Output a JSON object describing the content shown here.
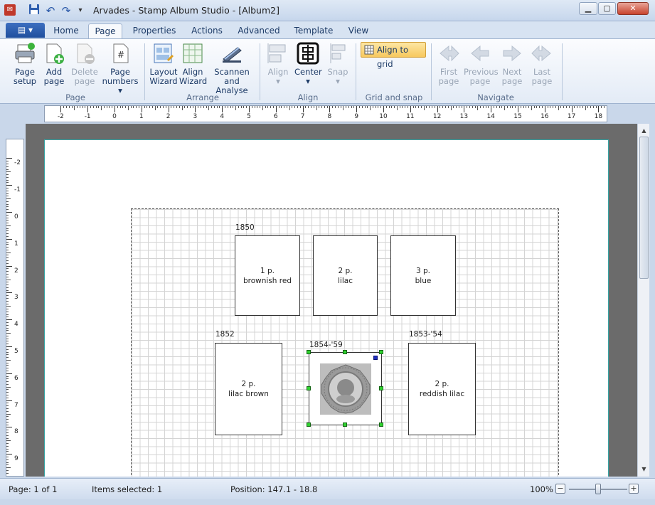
{
  "app": {
    "title": "Arvades - Stamp Album Studio - [Album2]"
  },
  "window_controls": {
    "minimize": "▁",
    "maximize": "▢",
    "close": "✕"
  },
  "tabs": {
    "file_label": "",
    "items": [
      {
        "label": "Home"
      },
      {
        "label": "Page",
        "active": true
      },
      {
        "label": "Properties"
      },
      {
        "label": "Actions"
      },
      {
        "label": "Advanced"
      },
      {
        "label": "Template"
      },
      {
        "label": "View"
      }
    ]
  },
  "ribbon": {
    "page_group": {
      "label": "Page",
      "page_setup": "Page setup",
      "add_page": "Add page",
      "delete_page": "Delete page",
      "page_numbers": "Page numbers"
    },
    "arrange_group": {
      "label": "Arrange",
      "layout_wizard": "Layout Wizard",
      "align_wizard": "Align Wizard",
      "scan_analyse": "Scannen and Analyse"
    },
    "align_group": {
      "label": "Align",
      "align": "Align",
      "center": "Center",
      "snap": "Snap"
    },
    "grid_group": {
      "label": "Grid and snap",
      "align_to_grid": "Align to grid"
    },
    "navigate_group": {
      "label": "Navigate",
      "first_page": "First page",
      "previous_page": "Previous page",
      "next_page": "Next page",
      "last_page": "Last page"
    }
  },
  "ruler": {
    "h_labels": [
      "-2",
      "-1",
      "0",
      "1",
      "2",
      "3",
      "4",
      "5",
      "6",
      "7",
      "8",
      "9",
      "10",
      "11",
      "12",
      "13",
      "14",
      "15",
      "16",
      "17",
      "18"
    ],
    "v_labels": [
      "-2",
      "-1",
      "0",
      "1",
      "2",
      "3",
      "4",
      "5",
      "6",
      "7",
      "8",
      "9"
    ]
  },
  "album": {
    "rows": [
      {
        "year": "1850"
      },
      {
        "year": "1852"
      },
      {
        "year": "1854-'59"
      },
      {
        "year": "1853-'54"
      }
    ],
    "stamps": [
      {
        "denomination": "1 p.",
        "color": "brownish red"
      },
      {
        "denomination": "2 p.",
        "color": "lilac"
      },
      {
        "denomination": "3 p.",
        "color": "blue"
      },
      {
        "denomination": "2 p.",
        "color": "lilac brown"
      },
      {
        "denomination": "2 p.",
        "color": "reddish lilac"
      }
    ]
  },
  "status": {
    "page": "Page: 1 of 1",
    "items_selected": "Items selected: 1",
    "position": "Position: 147.1 - 18.8",
    "zoom": "100%",
    "zoom_level": 1.0
  }
}
